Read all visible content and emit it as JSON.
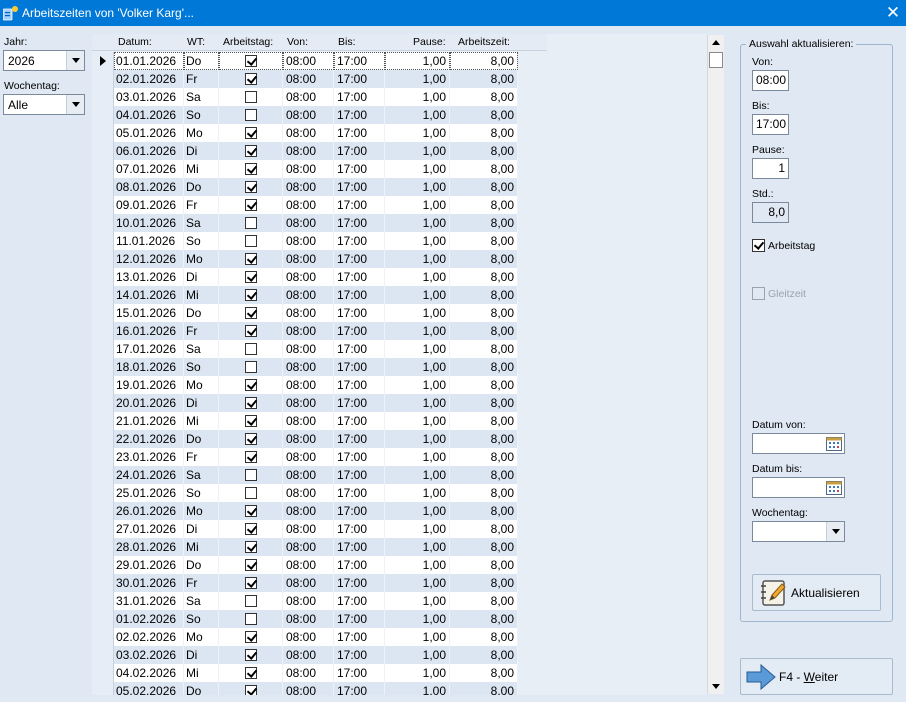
{
  "window": {
    "title": "Arbeitszeiten von 'Volker Karg'..."
  },
  "filters": {
    "jahr_label": "Jahr:",
    "jahr_value": "2026",
    "wochentag_label": "Wochentag:",
    "wochentag_value": "Alle"
  },
  "grid": {
    "columns": [
      "Datum:",
      "WT:",
      "Arbeitstag:",
      "Von:",
      "Bis:",
      "Pause:",
      "Arbeitszeit:"
    ],
    "rows": [
      {
        "datum": "01.01.2026",
        "wt": "Do",
        "arbeitstag": true,
        "von": "08:00",
        "bis": "17:00",
        "pause": "1,00",
        "arbeitszeit": "8,00"
      },
      {
        "datum": "02.01.2026",
        "wt": "Fr",
        "arbeitstag": true,
        "von": "08:00",
        "bis": "17:00",
        "pause": "1,00",
        "arbeitszeit": "8,00"
      },
      {
        "datum": "03.01.2026",
        "wt": "Sa",
        "arbeitstag": false,
        "von": "08:00",
        "bis": "17:00",
        "pause": "1,00",
        "arbeitszeit": "8,00"
      },
      {
        "datum": "04.01.2026",
        "wt": "So",
        "arbeitstag": false,
        "von": "08:00",
        "bis": "17:00",
        "pause": "1,00",
        "arbeitszeit": "8,00"
      },
      {
        "datum": "05.01.2026",
        "wt": "Mo",
        "arbeitstag": true,
        "von": "08:00",
        "bis": "17:00",
        "pause": "1,00",
        "arbeitszeit": "8,00"
      },
      {
        "datum": "06.01.2026",
        "wt": "Di",
        "arbeitstag": true,
        "von": "08:00",
        "bis": "17:00",
        "pause": "1,00",
        "arbeitszeit": "8,00"
      },
      {
        "datum": "07.01.2026",
        "wt": "Mi",
        "arbeitstag": true,
        "von": "08:00",
        "bis": "17:00",
        "pause": "1,00",
        "arbeitszeit": "8,00"
      },
      {
        "datum": "08.01.2026",
        "wt": "Do",
        "arbeitstag": true,
        "von": "08:00",
        "bis": "17:00",
        "pause": "1,00",
        "arbeitszeit": "8,00"
      },
      {
        "datum": "09.01.2026",
        "wt": "Fr",
        "arbeitstag": true,
        "von": "08:00",
        "bis": "17:00",
        "pause": "1,00",
        "arbeitszeit": "8,00"
      },
      {
        "datum": "10.01.2026",
        "wt": "Sa",
        "arbeitstag": false,
        "von": "08:00",
        "bis": "17:00",
        "pause": "1,00",
        "arbeitszeit": "8,00"
      },
      {
        "datum": "11.01.2026",
        "wt": "So",
        "arbeitstag": false,
        "von": "08:00",
        "bis": "17:00",
        "pause": "1,00",
        "arbeitszeit": "8,00"
      },
      {
        "datum": "12.01.2026",
        "wt": "Mo",
        "arbeitstag": true,
        "von": "08:00",
        "bis": "17:00",
        "pause": "1,00",
        "arbeitszeit": "8,00"
      },
      {
        "datum": "13.01.2026",
        "wt": "Di",
        "arbeitstag": true,
        "von": "08:00",
        "bis": "17:00",
        "pause": "1,00",
        "arbeitszeit": "8,00"
      },
      {
        "datum": "14.01.2026",
        "wt": "Mi",
        "arbeitstag": true,
        "von": "08:00",
        "bis": "17:00",
        "pause": "1,00",
        "arbeitszeit": "8,00"
      },
      {
        "datum": "15.01.2026",
        "wt": "Do",
        "arbeitstag": true,
        "von": "08:00",
        "bis": "17:00",
        "pause": "1,00",
        "arbeitszeit": "8,00"
      },
      {
        "datum": "16.01.2026",
        "wt": "Fr",
        "arbeitstag": true,
        "von": "08:00",
        "bis": "17:00",
        "pause": "1,00",
        "arbeitszeit": "8,00"
      },
      {
        "datum": "17.01.2026",
        "wt": "Sa",
        "arbeitstag": false,
        "von": "08:00",
        "bis": "17:00",
        "pause": "1,00",
        "arbeitszeit": "8,00"
      },
      {
        "datum": "18.01.2026",
        "wt": "So",
        "arbeitstag": false,
        "von": "08:00",
        "bis": "17:00",
        "pause": "1,00",
        "arbeitszeit": "8,00"
      },
      {
        "datum": "19.01.2026",
        "wt": "Mo",
        "arbeitstag": true,
        "von": "08:00",
        "bis": "17:00",
        "pause": "1,00",
        "arbeitszeit": "8,00"
      },
      {
        "datum": "20.01.2026",
        "wt": "Di",
        "arbeitstag": true,
        "von": "08:00",
        "bis": "17:00",
        "pause": "1,00",
        "arbeitszeit": "8,00"
      },
      {
        "datum": "21.01.2026",
        "wt": "Mi",
        "arbeitstag": true,
        "von": "08:00",
        "bis": "17:00",
        "pause": "1,00",
        "arbeitszeit": "8,00"
      },
      {
        "datum": "22.01.2026",
        "wt": "Do",
        "arbeitstag": true,
        "von": "08:00",
        "bis": "17:00",
        "pause": "1,00",
        "arbeitszeit": "8,00"
      },
      {
        "datum": "23.01.2026",
        "wt": "Fr",
        "arbeitstag": true,
        "von": "08:00",
        "bis": "17:00",
        "pause": "1,00",
        "arbeitszeit": "8,00"
      },
      {
        "datum": "24.01.2026",
        "wt": "Sa",
        "arbeitstag": false,
        "von": "08:00",
        "bis": "17:00",
        "pause": "1,00",
        "arbeitszeit": "8,00"
      },
      {
        "datum": "25.01.2026",
        "wt": "So",
        "arbeitstag": false,
        "von": "08:00",
        "bis": "17:00",
        "pause": "1,00",
        "arbeitszeit": "8,00"
      },
      {
        "datum": "26.01.2026",
        "wt": "Mo",
        "arbeitstag": true,
        "von": "08:00",
        "bis": "17:00",
        "pause": "1,00",
        "arbeitszeit": "8,00"
      },
      {
        "datum": "27.01.2026",
        "wt": "Di",
        "arbeitstag": true,
        "von": "08:00",
        "bis": "17:00",
        "pause": "1,00",
        "arbeitszeit": "8,00"
      },
      {
        "datum": "28.01.2026",
        "wt": "Mi",
        "arbeitstag": true,
        "von": "08:00",
        "bis": "17:00",
        "pause": "1,00",
        "arbeitszeit": "8,00"
      },
      {
        "datum": "29.01.2026",
        "wt": "Do",
        "arbeitstag": true,
        "von": "08:00",
        "bis": "17:00",
        "pause": "1,00",
        "arbeitszeit": "8,00"
      },
      {
        "datum": "30.01.2026",
        "wt": "Fr",
        "arbeitstag": true,
        "von": "08:00",
        "bis": "17:00",
        "pause": "1,00",
        "arbeitszeit": "8,00"
      },
      {
        "datum": "31.01.2026",
        "wt": "Sa",
        "arbeitstag": false,
        "von": "08:00",
        "bis": "17:00",
        "pause": "1,00",
        "arbeitszeit": "8,00"
      },
      {
        "datum": "01.02.2026",
        "wt": "So",
        "arbeitstag": false,
        "von": "08:00",
        "bis": "17:00",
        "pause": "1,00",
        "arbeitszeit": "8,00"
      },
      {
        "datum": "02.02.2026",
        "wt": "Mo",
        "arbeitstag": true,
        "von": "08:00",
        "bis": "17:00",
        "pause": "1,00",
        "arbeitszeit": "8,00"
      },
      {
        "datum": "03.02.2026",
        "wt": "Di",
        "arbeitstag": true,
        "von": "08:00",
        "bis": "17:00",
        "pause": "1,00",
        "arbeitszeit": "8,00"
      },
      {
        "datum": "04.02.2026",
        "wt": "Mi",
        "arbeitstag": true,
        "von": "08:00",
        "bis": "17:00",
        "pause": "1,00",
        "arbeitszeit": "8,00"
      },
      {
        "datum": "05.02.2026",
        "wt": "Do",
        "arbeitstag": true,
        "von": "08:00",
        "bis": "17:00",
        "pause": "1,00",
        "arbeitszeit": "8,00"
      }
    ]
  },
  "panel": {
    "group_title": "Auswahl aktualisieren:",
    "von_label": "Von:",
    "von_value": "08:00",
    "bis_label": "Bis:",
    "bis_value": "17:00",
    "pause_label": "Pause:",
    "pause_value": "1",
    "std_label": "Std.:",
    "std_value": "8,0",
    "arbeitstag_label": "Arbeitstag",
    "arbeitstag_checked": true,
    "gleitzeit_label": "Gleitzeit",
    "gleitzeit_checked": false,
    "datum_von_label": "Datum von:",
    "datum_von_value": "",
    "datum_bis_label": "Datum bis:",
    "datum_bis_value": "",
    "wochentag_label": "Wochentag:",
    "wochentag_value": "",
    "aktualisieren_label": "Aktualisieren",
    "weiter_prefix": "F4 - ",
    "weiter_hotkey": "W",
    "weiter_rest": "eiter"
  },
  "colors": {
    "titlebar": "#0078d7",
    "background": "#dfe8f3",
    "row_alt": "#dce6f2"
  }
}
